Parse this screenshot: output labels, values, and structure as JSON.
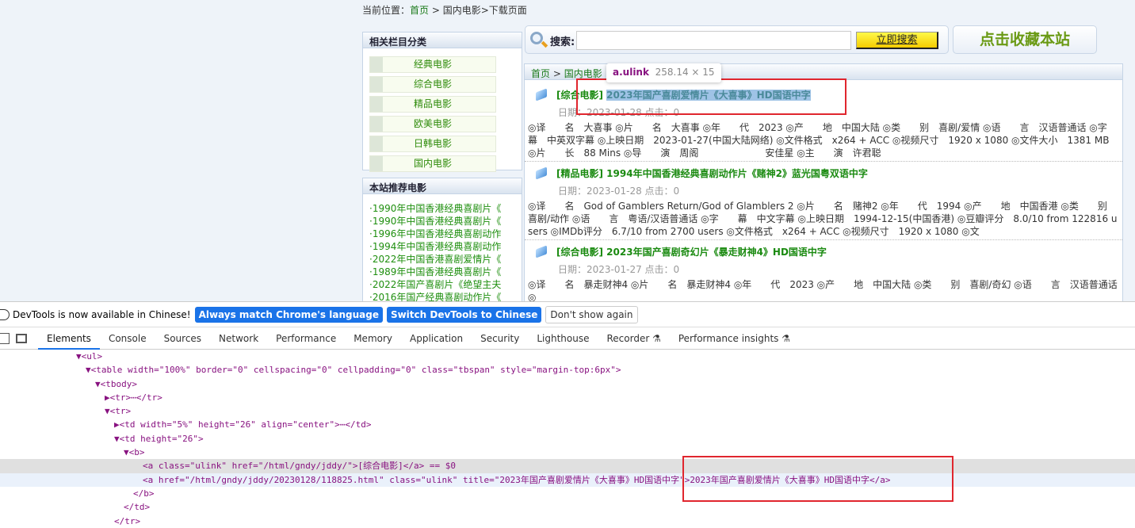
{
  "breadcrumb": {
    "prefix": "当前位置：",
    "home": "首页",
    "sep": " > ",
    "rest": "国内电影>下载页面"
  },
  "sidebar": {
    "categories_title": "相关栏目分类",
    "categories": [
      "经典电影",
      "综合电影",
      "精品电影",
      "欧美电影",
      "日韩电影",
      "国内电影"
    ],
    "recommend_title": "本站推荐电影",
    "recommend": [
      "·1990年中国香港经典喜剧片《",
      "·1990年中国香港经典喜剧片《",
      "·1996年中国香港经典喜剧动作",
      "·1994年中国香港经典喜剧动作",
      "·2022年中国香港喜剧爱情片《",
      "·1989年中国香港经典喜剧片《",
      "·2022年国产喜剧片《绝望主夫",
      "·2016年国产经典喜剧动作片《"
    ]
  },
  "search": {
    "label": "搜索:",
    "value": "",
    "button": "立即搜索",
    "favorite": "点击收藏本站"
  },
  "list": {
    "crumb_home": "首页",
    "crumb_sep": " > ",
    "crumb_cat": "国内电影",
    "items": [
      {
        "cat": "[综合电影]",
        "title": "2023年国产喜剧爱情片《大喜事》HD国语中字",
        "date": "日期：2023-01-28 点击：0",
        "desc": "◎译　　名　大喜事 ◎片　　名　大喜事 ◎年　　代　2023 ◎产　　地　中国大陆 ◎类　　别　喜剧/爱情 ◎语　　言　汉语普通话 ◎字　　幕　中英双字幕 ◎上映日期　2023-01-27(中国大陆网络) ◎文件格式　x264 + ACC ◎视频尺寸　1920 x 1080 ◎文件大小　1381 MB ◎片　　长　88 Mins ◎导　　演　周阁　　　　　　　安佳星 ◎主　　演　许君聪"
      },
      {
        "cat": "[精品电影]",
        "title": "1994年中国香港经典喜剧动作片《赌神2》蓝光国粤双语中字",
        "date": "日期：2023-01-28 点击：0",
        "desc": "◎译　　名　God of Gamblers Return/God of Glamblers 2 ◎片　　名　赌神2 ◎年　　代　1994 ◎产　　地　中国香港 ◎类　　别　喜剧/动作 ◎语　　言　粤语/汉语普通话 ◎字　　幕　中文字幕 ◎上映日期　1994-12-15(中国香港) ◎豆瓣评分　8.0/10 from 122816 users ◎IMDb评分　6.7/10 from 2700 users ◎文件格式　x264 + ACC ◎视频尺寸　1920 x 1080 ◎文"
      },
      {
        "cat": "[综合电影]",
        "title": "2023年国产喜剧奇幻片《暴走财神4》HD国语中字",
        "date": "日期：2023-01-27 点击：0",
        "desc": "◎译　　名　暴走财神4 ◎片　　名　暴走财神4 ◎年　　代　2023 ◎产　　地　中国大陆 ◎类　　别　喜剧/奇幻 ◎语　　言　汉语普通话 ◎"
      }
    ]
  },
  "tooltip": {
    "name": "a.ulink",
    "size": "258.14 × 15"
  },
  "devtools": {
    "banner": "DevTools is now available in Chinese!",
    "btn_match": "Always match Chrome's language",
    "btn_switch": "Switch DevTools to Chinese",
    "btn_dismiss": "Don't show again",
    "tabs": [
      "Elements",
      "Console",
      "Sources",
      "Network",
      "Performance",
      "Memory",
      "Application",
      "Security",
      "Lighthouse",
      "Recorder ⚗",
      "Performance insights ⚗"
    ],
    "tree": [
      {
        "indent": 8,
        "text": "▼<ul>"
      },
      {
        "indent": 9,
        "text": "▼<table width=\"100%\" border=\"0\" cellspacing=\"0\" cellpadding=\"0\" class=\"tbspan\" style=\"margin-top:6px\">"
      },
      {
        "indent": 10,
        "text": "▼<tbody>"
      },
      {
        "indent": 11,
        "text": "▶<tr>⋯</tr>"
      },
      {
        "indent": 11,
        "text": "▼<tr>"
      },
      {
        "indent": 12,
        "text": "▶<td width=\"5%\" height=\"26\" align=\"center\">⋯</td>"
      },
      {
        "indent": 12,
        "text": "▼<td height=\"26\">"
      },
      {
        "indent": 13,
        "text": "▼<b>"
      },
      {
        "indent": 15,
        "text": "<a class=\"ulink\" href=\"/html/gndy/jddy/\">[综合电影]</a> == $0",
        "cls": "sel"
      },
      {
        "indent": 15,
        "text": "<a href=\"/html/gndy/jddy/20230128/118825.html\" class=\"ulink\" title=\"2023年国产喜剧爱情片《大喜事》HD国语中字\">2023年国产喜剧爱情片《大喜事》HD国语中字</a>",
        "cls": "hov"
      },
      {
        "indent": 14,
        "text": "</b>"
      },
      {
        "indent": 13,
        "text": "</td>"
      },
      {
        "indent": 12,
        "text": "</tr>"
      }
    ]
  }
}
